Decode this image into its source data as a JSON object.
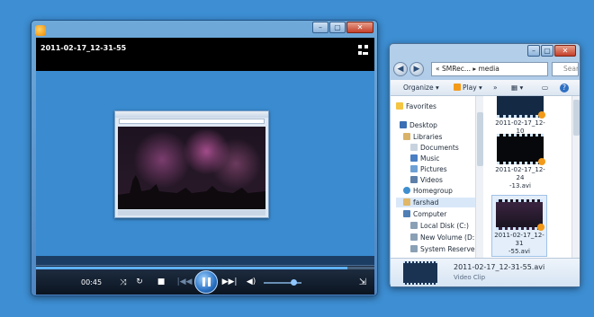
{
  "player": {
    "title": "2011-02-17_12-31-55",
    "time": "00:45",
    "progress_fraction": 0.92,
    "volume_fraction": 0.8
  },
  "explorer": {
    "breadcrumb": "« SMRec... ▸ media",
    "search_placeholder": "Sear",
    "toolbar": {
      "organize": "Organize ▾",
      "play": "Play ▾",
      "more": "»"
    },
    "nav": [
      {
        "label": "Favorites",
        "icon": "star-icon",
        "color": "#f4c542"
      },
      {
        "label": "Desktop",
        "icon": "desktop-icon",
        "color": "#3b6fb3"
      },
      {
        "label": "Libraries",
        "icon": "libraries-icon",
        "color": "#d9b36a"
      },
      {
        "label": "Documents",
        "icon": "documents-icon",
        "color": "#c8d3df"
      },
      {
        "label": "Music",
        "icon": "music-icon",
        "color": "#4a7fc2"
      },
      {
        "label": "Pictures",
        "icon": "pictures-icon",
        "color": "#6fa0d4"
      },
      {
        "label": "Videos",
        "icon": "videos-icon",
        "color": "#5d7fa8"
      },
      {
        "label": "Homegroup",
        "icon": "homegroup-icon",
        "color": "#3e8fd0"
      },
      {
        "label": "farshad",
        "icon": "user-folder-icon",
        "color": "#e1b766"
      },
      {
        "label": "Computer",
        "icon": "computer-icon",
        "color": "#4f7fb5"
      },
      {
        "label": "Local Disk (C:)",
        "icon": "drive-icon",
        "color": "#8aa0b5"
      },
      {
        "label": "New Volume (D:",
        "icon": "drive-icon",
        "color": "#8aa0b5"
      },
      {
        "label": "System Reserved",
        "icon": "drive-icon",
        "color": "#8aa0b5"
      }
    ],
    "files": [
      {
        "name": "2011-02-17_12-10\n-18.avi"
      },
      {
        "name": "2011-02-17_12-24\n-13.avi"
      },
      {
        "name": "2011-02-17_12-31\n-55.avi"
      }
    ],
    "details": {
      "name": "2011-02-17_12-31-55.avi",
      "type": "Video Clip"
    }
  }
}
